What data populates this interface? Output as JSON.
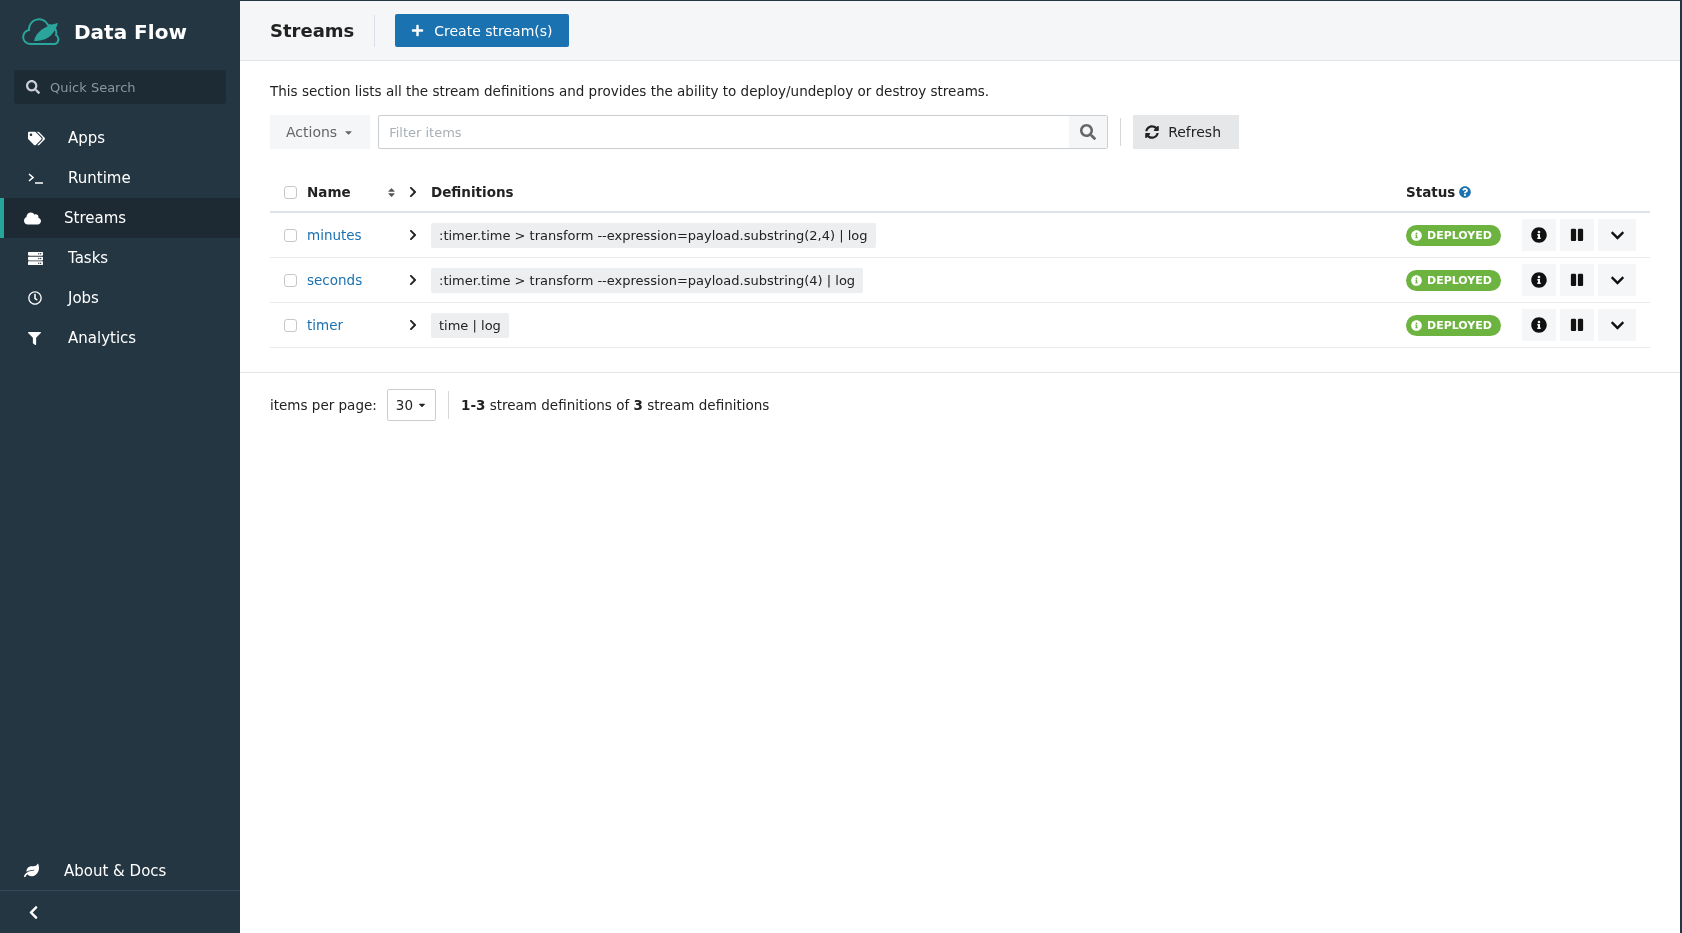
{
  "sidebar": {
    "brand": "Data Flow",
    "search": {
      "placeholder": "Quick Search"
    },
    "items": [
      {
        "label": "Apps",
        "selected": false
      },
      {
        "label": "Runtime",
        "selected": false
      },
      {
        "label": "Streams",
        "selected": true
      },
      {
        "label": "Tasks",
        "selected": false
      },
      {
        "label": "Jobs",
        "selected": false
      },
      {
        "label": "Analytics",
        "selected": false
      }
    ],
    "footer_item": "About & Docs"
  },
  "header": {
    "title": "Streams",
    "create_button": "Create stream(s)"
  },
  "description": "This section lists all the stream definitions and provides the ability to deploy/undeploy or destroy streams.",
  "toolbar": {
    "actions": "Actions",
    "filter": {
      "placeholder": "Filter items"
    },
    "refresh": "Refresh"
  },
  "table": {
    "columns": [
      "Name",
      "Definitions",
      "Status"
    ],
    "select_all_checked": false,
    "rows": [
      {
        "name": "minutes",
        "definition": ":timer.time > transform --expression=payload.substring(2,4) | log",
        "status": "DEPLOYED",
        "checked": false,
        "expanded": false
      },
      {
        "name": "seconds",
        "definition": ":timer.time > transform --expression=payload.substring(4) | log",
        "status": "DEPLOYED",
        "checked": false,
        "expanded": false
      },
      {
        "name": "timer",
        "definition": "time | log",
        "status": "DEPLOYED",
        "checked": false,
        "expanded": false
      }
    ]
  },
  "pagination": {
    "label": "items per page:",
    "page_size": "30",
    "summary": "**1-3** stream definitions of **3** stream definitions"
  }
}
